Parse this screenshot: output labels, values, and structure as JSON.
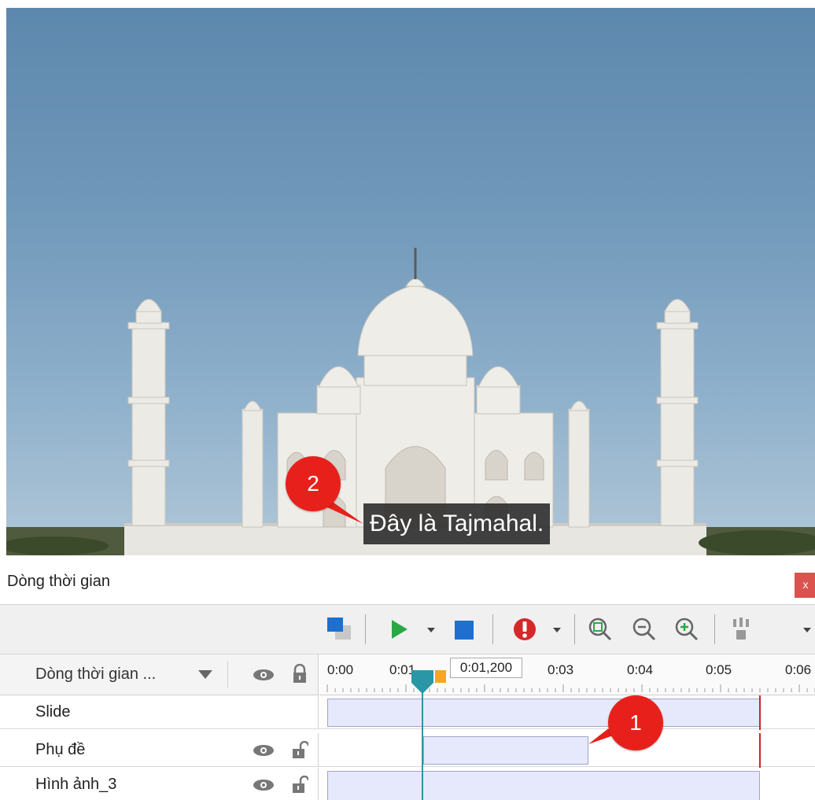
{
  "slide": {
    "caption": "Đây là Tajmahal.",
    "callouts": [
      "1",
      "2"
    ]
  },
  "panel": {
    "title": "Dòng thời gian",
    "close_label": "x"
  },
  "toolbar": {
    "items": [
      "layer-icon",
      "play-icon",
      "play-dropdown-icon",
      "stop-icon",
      "record-icon",
      "record-dropdown-icon",
      "zoom-fit-icon",
      "zoom-out-icon",
      "zoom-in-icon",
      "align-icon",
      "more-dropdown-icon"
    ]
  },
  "timeline": {
    "header_title": "Dòng thời gian ...",
    "current_time": "0:01,200",
    "ticks": [
      "0:00",
      "0:01",
      "0:03",
      "0:04",
      "0:05",
      "0:06"
    ],
    "rows": [
      {
        "label": "Slide",
        "has_controls": false
      },
      {
        "label": "Phụ đề",
        "has_controls": true
      },
      {
        "label": "Hình ảnh_3",
        "has_controls": true
      }
    ]
  },
  "colors": {
    "accent_playhead": "#2a97a6",
    "callout": "#e8201b",
    "end_marker": "#d42020",
    "bar_fill": "#e6e9fb"
  }
}
